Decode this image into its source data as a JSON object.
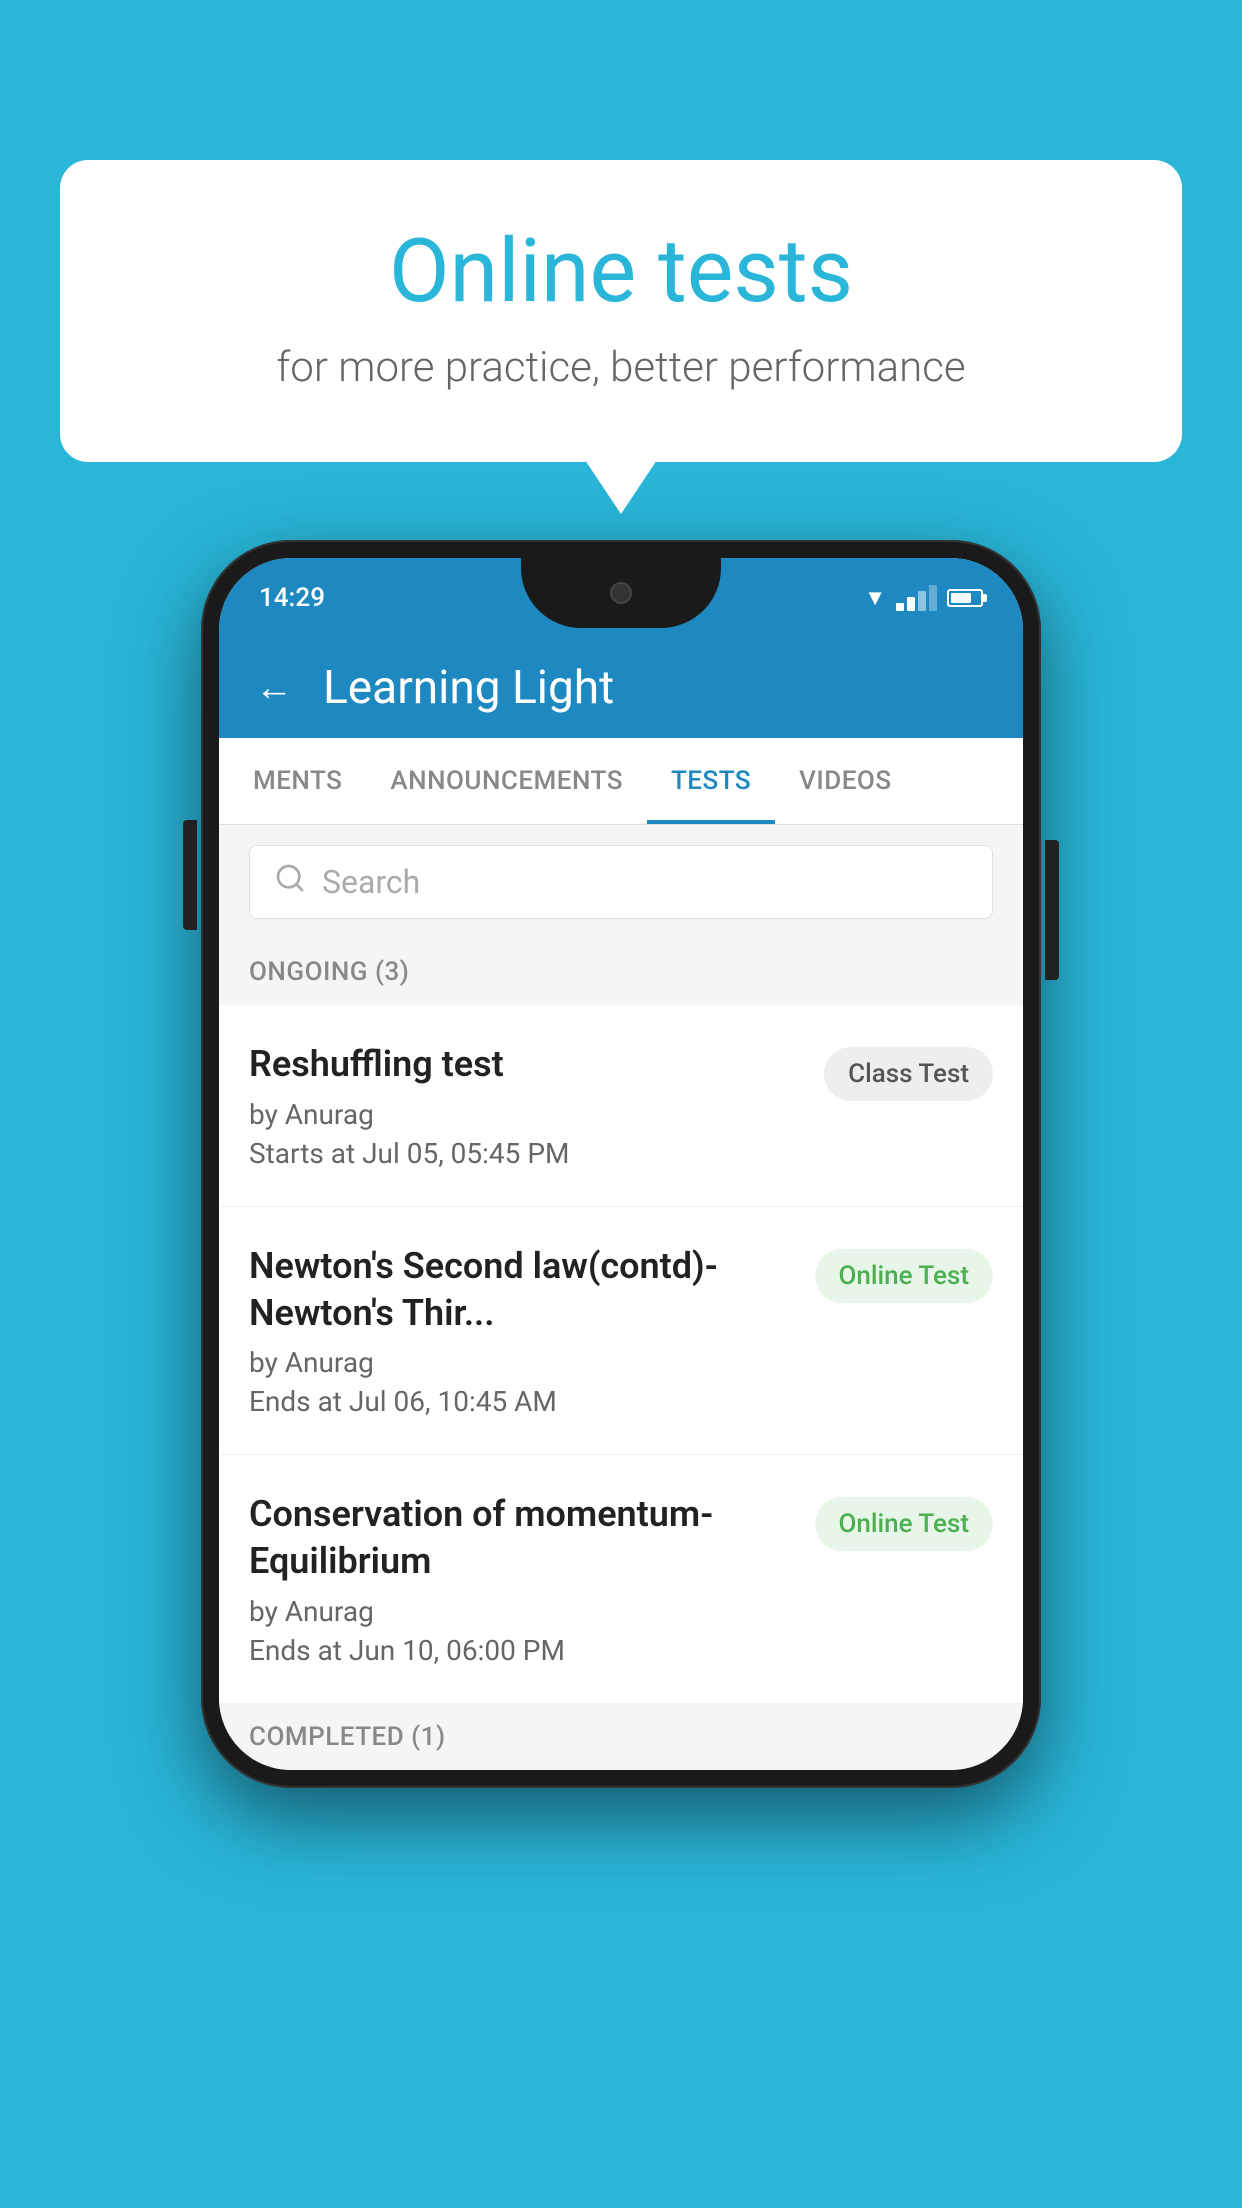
{
  "background_color": "#29b6d8",
  "speech_bubble": {
    "title": "Online tests",
    "subtitle": "for more practice, better performance"
  },
  "phone": {
    "status_bar": {
      "time": "14:29"
    },
    "app_header": {
      "title": "Learning Light",
      "back_label": "←"
    },
    "tabs": [
      {
        "label": "MENTS",
        "active": false
      },
      {
        "label": "ANNOUNCEMENTS",
        "active": false
      },
      {
        "label": "TESTS",
        "active": true
      },
      {
        "label": "VIDEOS",
        "active": false
      }
    ],
    "search": {
      "placeholder": "Search"
    },
    "ongoing_section": {
      "title": "ONGOING (3)"
    },
    "test_items": [
      {
        "name": "Reshuffling test",
        "author": "by Anurag",
        "time_label": "Starts at  Jul 05, 05:45 PM",
        "badge": "Class Test",
        "badge_type": "class"
      },
      {
        "name": "Newton's Second law(contd)-Newton's Thir...",
        "author": "by Anurag",
        "time_label": "Ends at  Jul 06, 10:45 AM",
        "badge": "Online Test",
        "badge_type": "online"
      },
      {
        "name": "Conservation of momentum-Equilibrium",
        "author": "by Anurag",
        "time_label": "Ends at  Jun 10, 06:00 PM",
        "badge": "Online Test",
        "badge_type": "online"
      }
    ],
    "completed_section": {
      "title": "COMPLETED (1)"
    }
  }
}
